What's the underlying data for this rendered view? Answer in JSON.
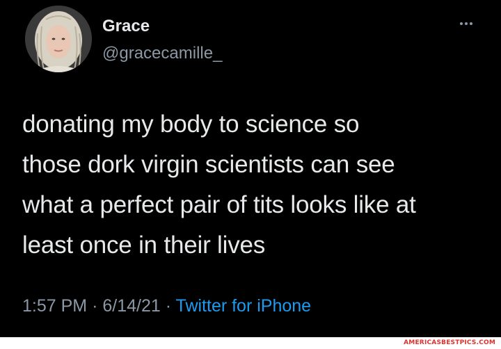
{
  "tweet": {
    "author": {
      "display_name": "Grace",
      "handle": "@gracecamille_",
      "avatar_icon": "profile-photo"
    },
    "more_icon": "more-horizontal-icon",
    "text_lines": [
      "donating my body to science so",
      "those dork virgin scientists can see",
      "what a perfect pair of tits looks like at",
      "least once in their lives"
    ],
    "time": "1:57 PM",
    "separator": "·",
    "date": "6/14/21",
    "source": "Twitter for iPhone"
  },
  "watermark": {
    "text": "AMERICASBESTPICS.COM",
    "color": "#e0322c"
  },
  "colors": {
    "background": "#000000",
    "text_primary": "#e7e9ea",
    "text_secondary": "#8b98a5",
    "link": "#1d9bf0"
  }
}
